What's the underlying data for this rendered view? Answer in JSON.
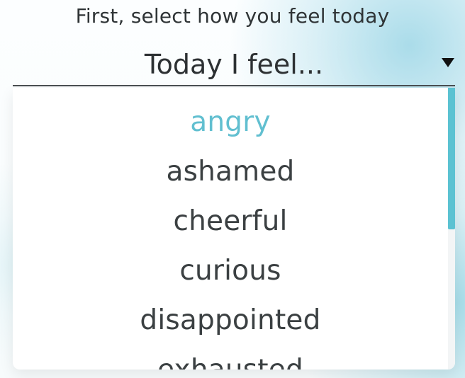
{
  "heading": "First, select how you feel today",
  "select": {
    "value": "Today I feel..."
  },
  "dropdown": {
    "options": [
      "angry",
      "ashamed",
      "cheerful",
      "curious",
      "disappointed",
      "exhausted"
    ],
    "highlighted_option": "angry"
  },
  "icons": {
    "select_arrow": "caret-down-icon"
  },
  "colors": {
    "accent": "#61bfd0",
    "scrollbar": "#5bc2d2",
    "text": "#3b4042"
  }
}
